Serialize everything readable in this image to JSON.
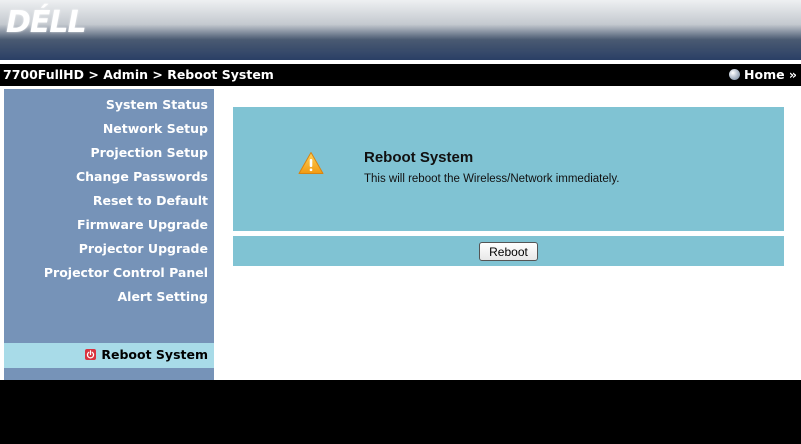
{
  "header": {
    "logo_text": "DÉLL"
  },
  "breadcrumb": {
    "text": "7700FullHD > Admin > Reboot System"
  },
  "home": {
    "label": "Home »",
    "icon": "globe-icon"
  },
  "sidebar": {
    "items": [
      {
        "label": "System Status"
      },
      {
        "label": "Network Setup"
      },
      {
        "label": "Projection Setup"
      },
      {
        "label": "Change Passwords"
      },
      {
        "label": "Reset to Default"
      },
      {
        "label": "Firmware Upgrade"
      },
      {
        "label": "Projector Upgrade"
      },
      {
        "label": "Projector Control Panel"
      },
      {
        "label": "Alert Setting"
      }
    ],
    "active": {
      "label": "Reboot System",
      "icon": "power-icon"
    }
  },
  "panel": {
    "icon": "warning-icon",
    "title": "Reboot System",
    "message": "This will reboot the Wireless/Network immediately.",
    "button_label": "Reboot"
  },
  "colors": {
    "sidebar_bg": "#7693b8",
    "active_bg": "#a8dbe8",
    "panel_bg": "#80c3d3",
    "warning": "#f5a31a",
    "power": "#d9323f"
  }
}
